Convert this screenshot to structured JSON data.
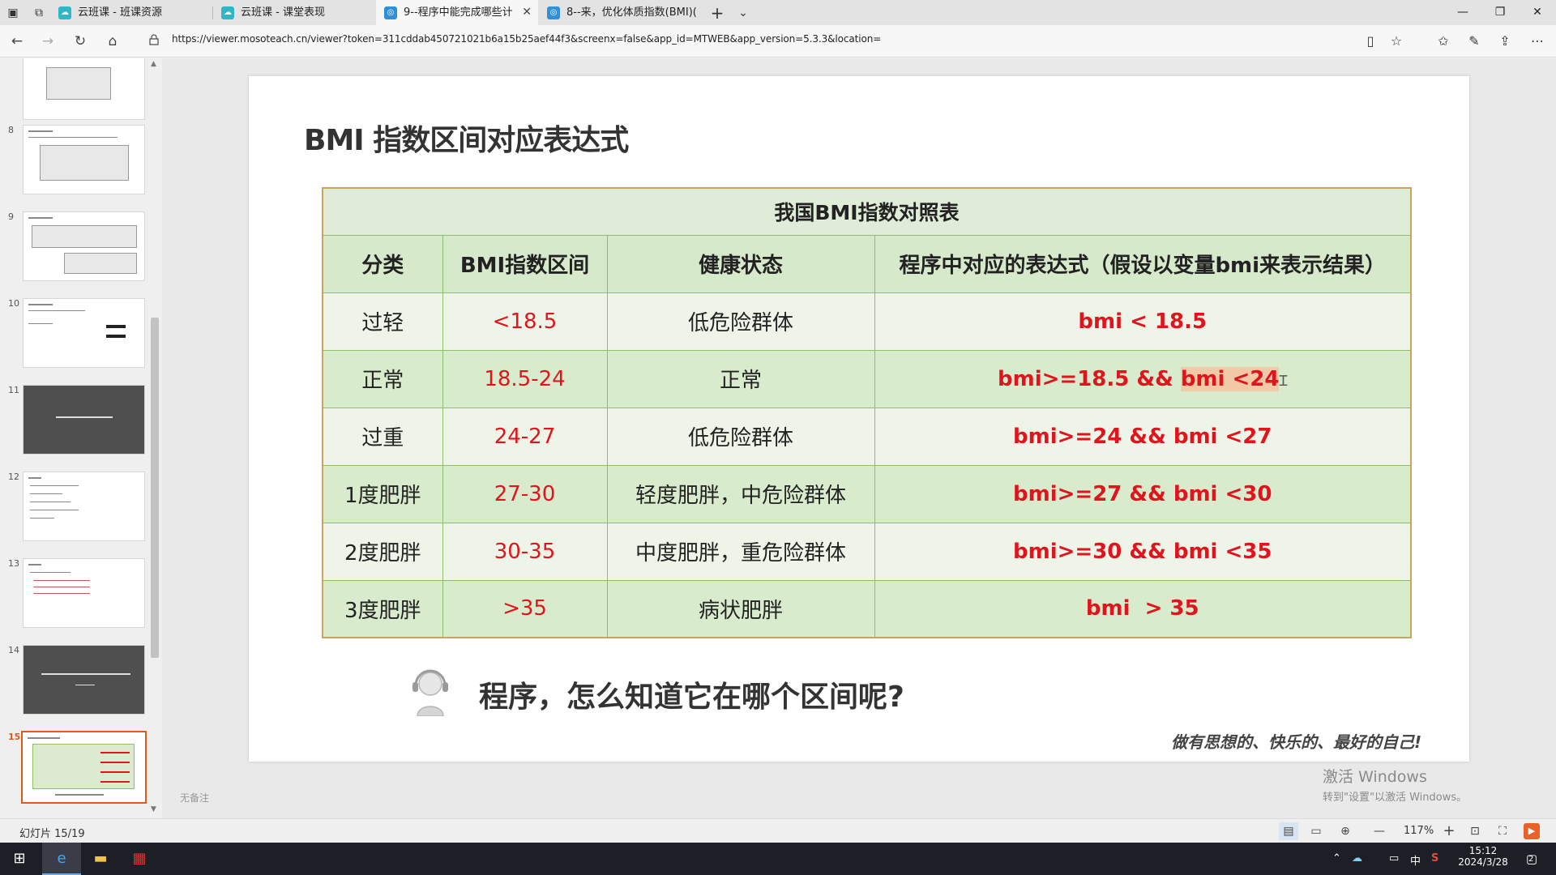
{
  "browser": {
    "tabs": [
      {
        "title": "云班课 - 班课资源"
      },
      {
        "title": "云班课 - 课堂表现"
      },
      {
        "title": "9--程序中能完成哪些计"
      },
      {
        "title": "8--来，优化体质指数(BMI)("
      }
    ],
    "url": "https://viewer.mosoteach.cn/viewer?token=311cddab450721021b6a15b25aef44f3&screenx=false&app_id=MTWEB&app_version=5.3.3&location="
  },
  "thumbnails": {
    "numbers": [
      "8",
      "9",
      "10",
      "11",
      "12",
      "13",
      "14",
      "15"
    ]
  },
  "slide": {
    "title": "BMI 指数区间对应表达式",
    "table": {
      "caption": "我国BMI指数对照表",
      "headers": [
        "分类",
        "BMI指数区间",
        "健康状态",
        "程序中对应的表达式（假设以变量bmi来表示结果）"
      ],
      "rows": [
        {
          "category": "过轻",
          "range": "<18.5",
          "health": "低危险群体",
          "expr": "bmi < 18.5"
        },
        {
          "category": "正常",
          "range": "18.5-24",
          "health": "正常",
          "expr_a": "bmi>=18.5 && ",
          "expr_b": "bmi <24"
        },
        {
          "category": "过重",
          "range": "24-27",
          "health": "低危险群体",
          "expr": "bmi>=24 && bmi <27"
        },
        {
          "category": "1度肥胖",
          "range": "27-30",
          "health": "轻度肥胖，中危险群体",
          "expr": "bmi>=27 && bmi <30"
        },
        {
          "category": "2度肥胖",
          "range": "30-35",
          "health": "中度肥胖，重危险群体",
          "expr": "bmi>=30 && bmi <35"
        },
        {
          "category": "3度肥胖",
          "range": ">35",
          "health": "病状肥胖",
          "expr": "bmi  > 35"
        }
      ]
    },
    "question": "程序，怎么知道它在哪个区间呢?",
    "slogan": "做有思想的、快乐的、最好的自己!"
  },
  "notes_placeholder": "无备注",
  "watermark": {
    "line1": "激活 Windows",
    "line2": "转到\"设置\"以激活 Windows。"
  },
  "status": {
    "slide_counter": "幻灯片 15/19",
    "zoom": "117%"
  },
  "taskbar": {
    "time": "15:12",
    "date": "2024/3/28",
    "ime": "中",
    "notif_count": "2"
  },
  "colors": {
    "accent": "#e0141c",
    "table_border": "#8cbf6a",
    "highlight": "#f1c9a7"
  }
}
